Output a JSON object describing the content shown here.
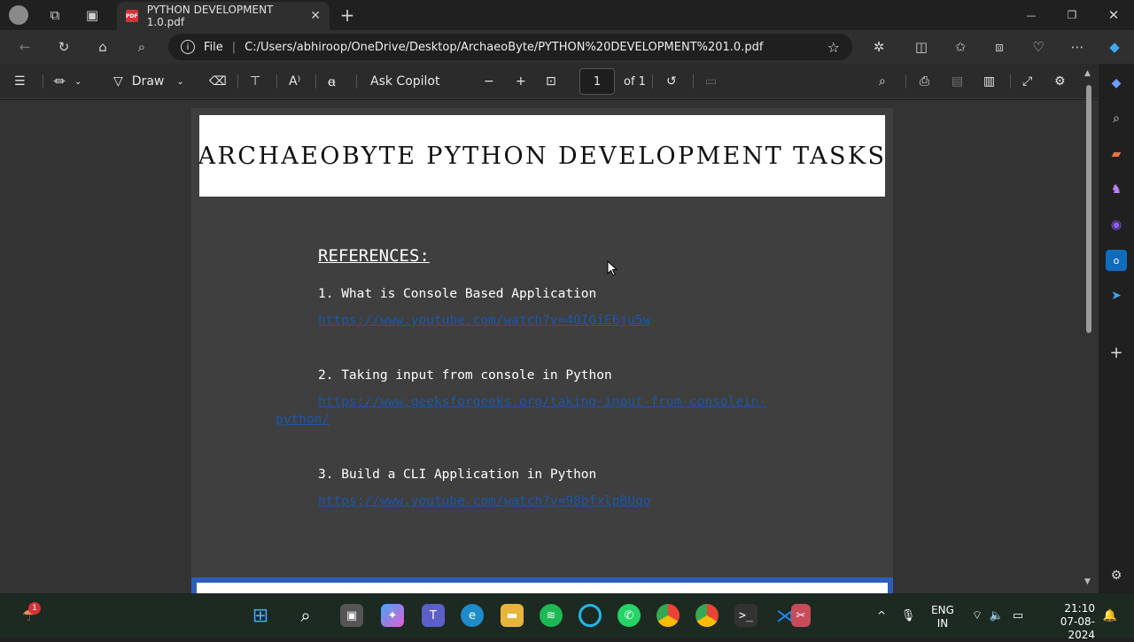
{
  "tab": {
    "title": "PYTHON DEVELOPMENT 1.0.pdf",
    "badge": "PDF",
    "close": "✕"
  },
  "window": {
    "minimize": "—",
    "maximize": "❐",
    "close": "✕",
    "new_tab": "+"
  },
  "address": {
    "scheme_label": "File",
    "url": "C:/Users/abhiroop/OneDrive/Desktop/ArchaeoByte/PYTHON%20DEVELOPMENT%201.0.pdf"
  },
  "toolbar": {
    "draw_label": "Draw",
    "copilot_label": "Ask Copilot",
    "page_current": "1",
    "page_total": "of 1"
  },
  "document": {
    "title": "ARCHAEOBYTE PYTHON DEVELOPMENT TASKS",
    "references_heading": "REFERENCES:",
    "items": [
      {
        "label": "1. What is Console Based Application",
        "link": "https://www.youtube.com/watch?v=4OIGiE6ju5w",
        "link_cont": ""
      },
      {
        "label": "2. Taking input from console in Python",
        "link": "https://www.geeksforgeeks.org/taking-input-from-consolein-",
        "link_cont": "python/"
      },
      {
        "label": "3. Build a CLI Application in Python",
        "link": "https://www.youtube.com/watch?v=98bfxlpBUqo",
        "link_cont": ""
      }
    ]
  },
  "taskbar": {
    "notification_count": "1",
    "lang_line1": "ENG",
    "lang_line2": "IN",
    "time": "21:10",
    "date": "07-08-2024"
  },
  "colors": {
    "accent_link": "#1a56b0",
    "pdf_red": "#d13438",
    "taskbar": "#1c2a22"
  }
}
